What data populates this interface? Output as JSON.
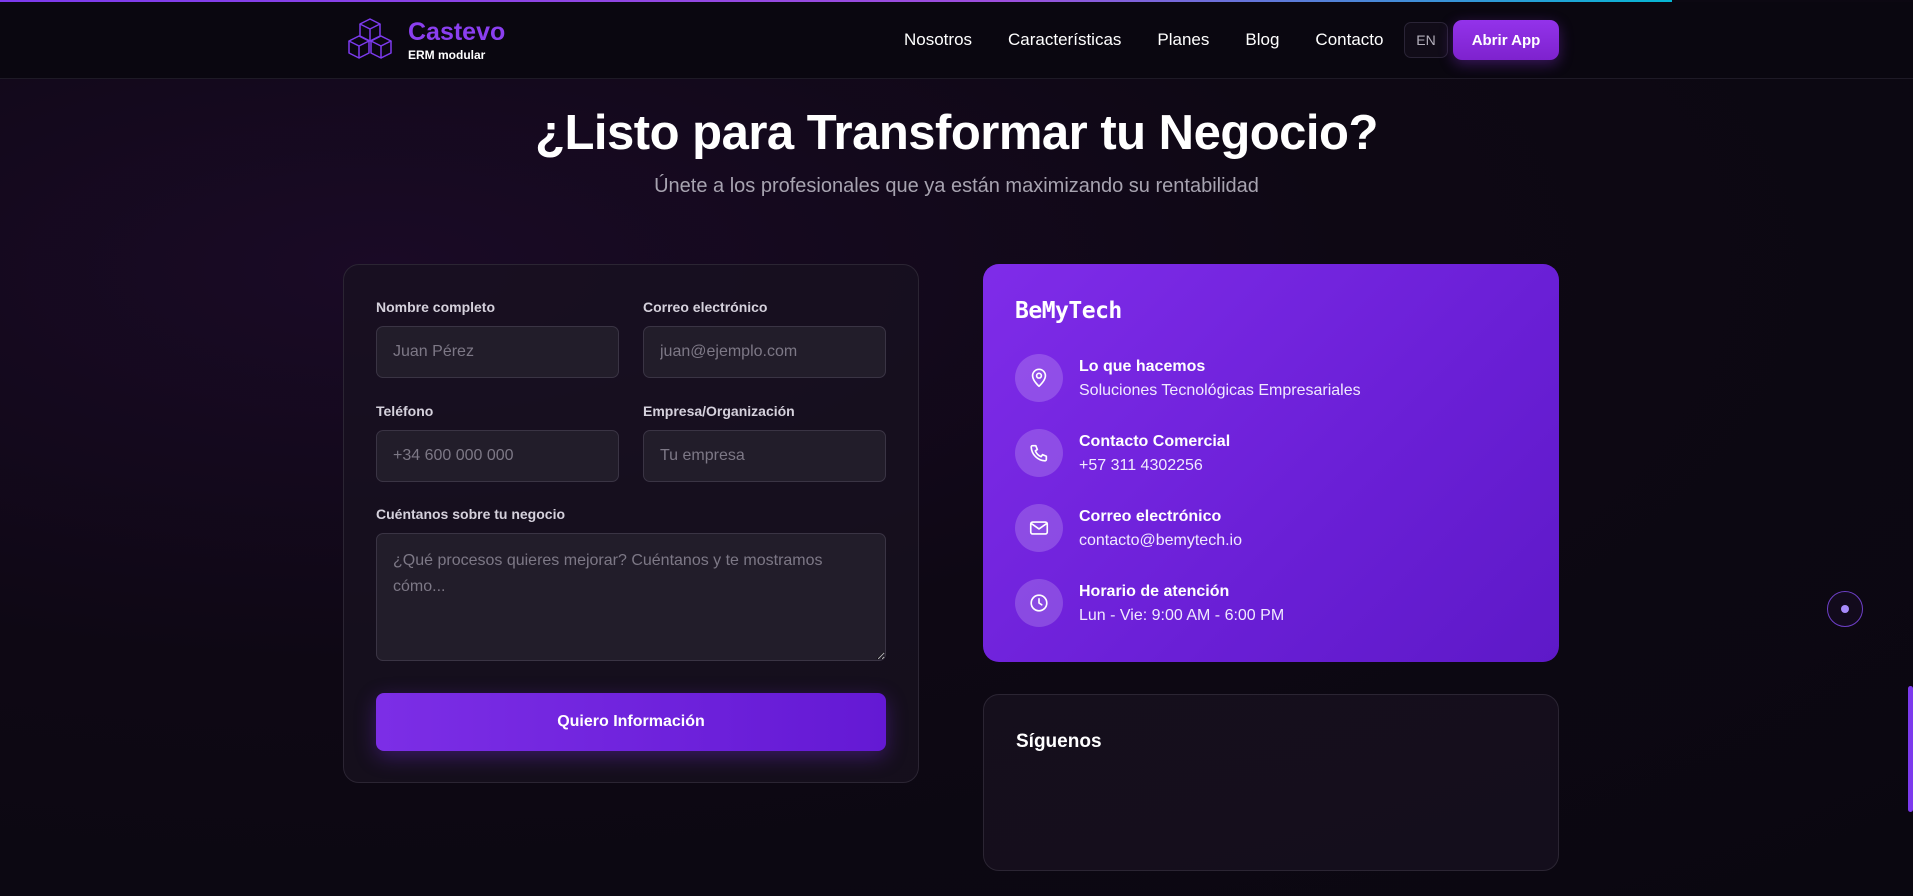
{
  "brand": {
    "name": "Castevo",
    "tagline": "ERM modular",
    "icon": "cubes-logo-icon"
  },
  "nav": {
    "items": [
      "Nosotros",
      "Características",
      "Planes",
      "Blog",
      "Contacto"
    ],
    "lang_label": "EN",
    "app_button": "Abrir App"
  },
  "hero": {
    "title": "¿Listo para Transformar tu Negocio?",
    "subtitle": "Únete a los profesionales que ya están maximizando su rentabilidad"
  },
  "form": {
    "name_label": "Nombre completo",
    "name_placeholder": "Juan Pérez",
    "email_label": "Correo electrónico",
    "email_placeholder": "juan@ejemplo.com",
    "phone_label": "Teléfono",
    "phone_placeholder": "+34 600 000 000",
    "company_label": "Empresa/Organización",
    "company_placeholder": "Tu empresa",
    "message_label": "Cuéntanos sobre tu negocio",
    "message_placeholder": "¿Qué procesos quieres mejorar? Cuéntanos y te mostramos cómo...",
    "submit_label": "Quiero Información"
  },
  "info": {
    "title": "BeMyTech",
    "items": [
      {
        "icon": "map-pin-icon",
        "label": "Lo que hacemos",
        "value": "Soluciones Tecnológicas Empresariales"
      },
      {
        "icon": "phone-icon",
        "label": "Contacto Comercial",
        "value": "+57 311 4302256"
      },
      {
        "icon": "mail-icon",
        "label": "Correo electrónico",
        "value": "contacto@bemytech.io"
      },
      {
        "icon": "clock-icon",
        "label": "Horario de atención",
        "value": "Lun - Vie: 9:00 AM - 6:00 PM"
      }
    ]
  },
  "social": {
    "title": "Síguenos"
  },
  "colors": {
    "accent": "#7c3aed",
    "brand": "#8b3ff0",
    "background": "#0e0814"
  }
}
